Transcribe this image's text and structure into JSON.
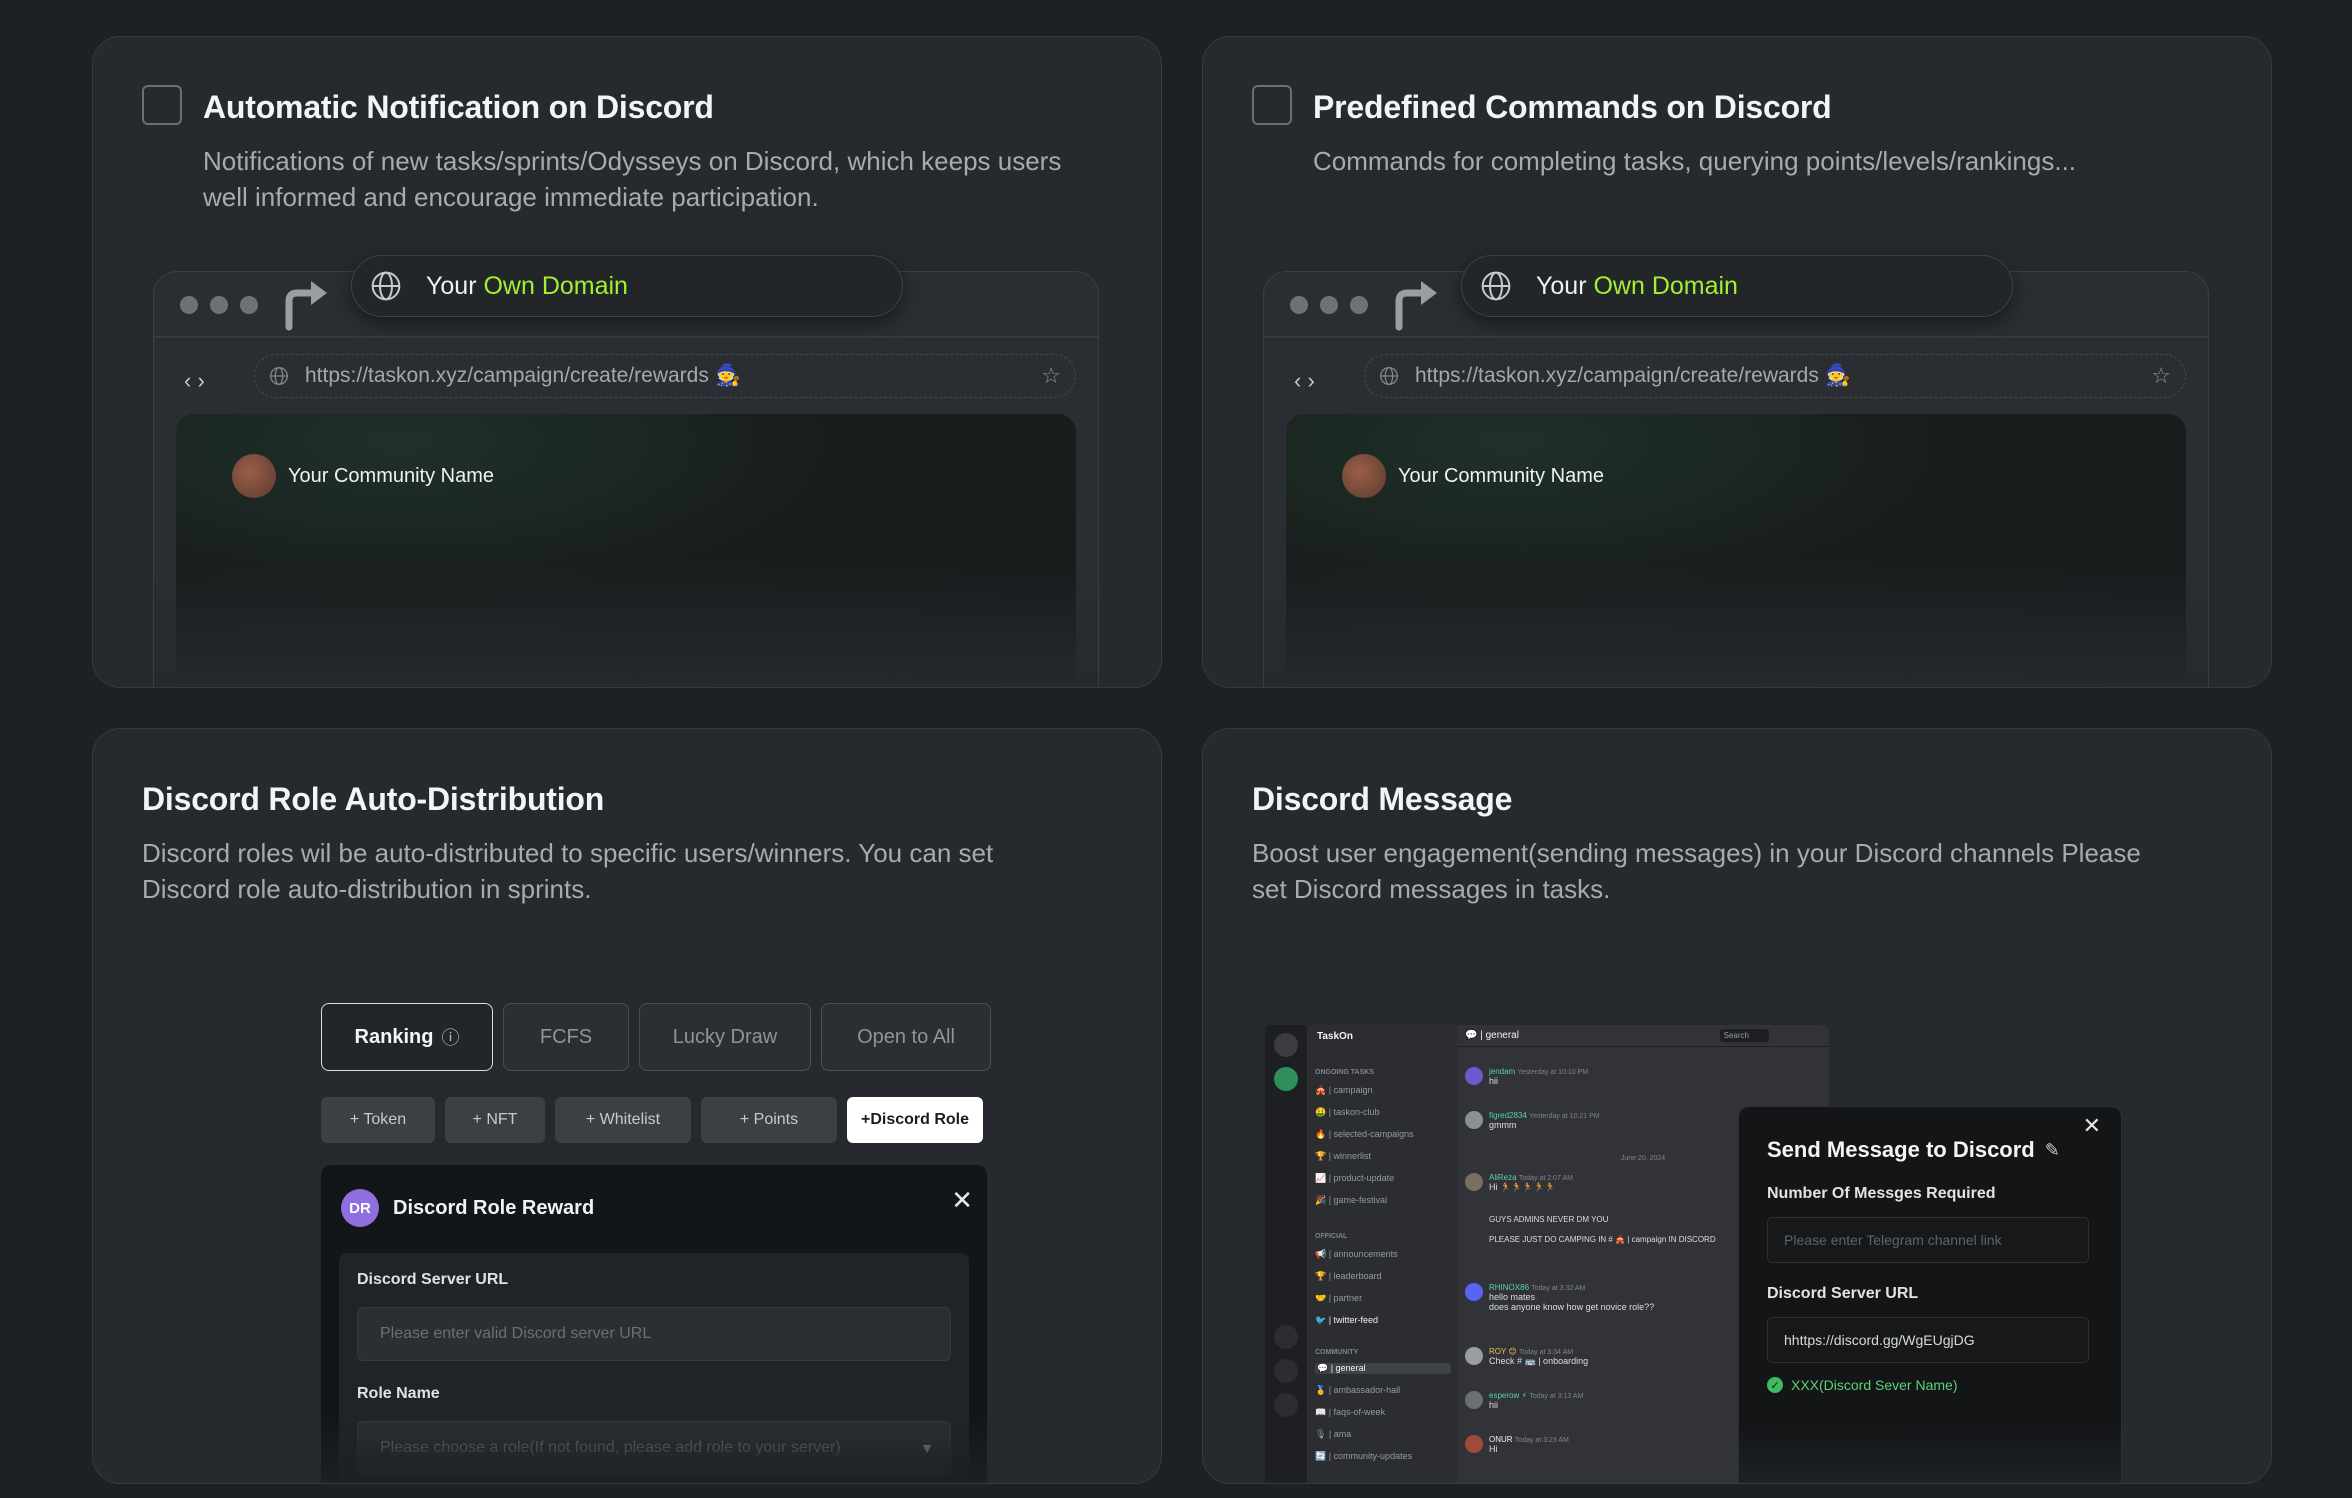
{
  "cards": [
    {
      "title": "Automatic Notification on Discord",
      "desc_line1": "Notifications of new tasks/sprints/Odysseys on Discord, which keeps users",
      "desc_line2": "well informed and encourage immediate participation."
    },
    {
      "title": "Predefined Commands on Discord",
      "desc_line1": "Commands for completing tasks, querying points/levels/rankings...",
      "desc_line2": ""
    },
    {
      "title": "Discord Role Auto-Distribution",
      "desc_line1": "Discord roles wil be auto-distributed to specific users/winners. You can set",
      "desc_line2": "Discord role auto-distribution in sprints."
    },
    {
      "title": "Discord Message",
      "desc_line1": "Boost user engagement(sending messages) in your Discord channels Please",
      "desc_line2": "set Discord messages in tasks."
    }
  ],
  "browser": {
    "domain_prefix": "Your ",
    "domain_highlight": "Own Domain",
    "url": "https://taskon.xyz/campaign/create/rewards 🧙",
    "community_name": "Your Community Name",
    "highlight_color": "#a3f033"
  },
  "role_reward": {
    "tabs": [
      "Ranking",
      "FCFS",
      "Lucky Draw",
      "Open to All"
    ],
    "tab_info_icon": "ⓘ",
    "chips": [
      "+ Token",
      "+ NFT",
      "+ Whitelist",
      "+ Points",
      "+Discord Role"
    ],
    "badge": "DR",
    "panel_title": "Discord Role Reward",
    "close": "✕",
    "server_url_label": "Discord Server URL",
    "server_url_placeholder": "Please enter valid Discord server URL",
    "role_name_label": "Role Name",
    "role_name_placeholder": "Please choose a role(If not found, please add role to your server)"
  },
  "discord": {
    "server": "TaskOn",
    "current_channel": "💬 | general",
    "search": "Search",
    "categories": [
      "ONGOING TASKS",
      "OFFICIAL",
      "COMMUNITY"
    ],
    "channels_ongoing": [
      "🎪 | campaign",
      "🤑 | taskon-club",
      "🔥 | selected-campaigns",
      "🏆 | winnerlist",
      "📈 | product-update",
      "🎉 | game-festival"
    ],
    "channels_official": [
      "📢 | announcements",
      "🏆 | leaderboard",
      "🤝 | partner",
      "🐦 | twitter-feed"
    ],
    "channels_community": [
      "💬 | general",
      "🏅 | ambassador-hall",
      "📖 | faqs-of-week",
      "🎙 | ama",
      "🔄 | community-updates"
    ],
    "date_divider": "June 20, 2024",
    "messages": [
      {
        "name": "jendam",
        "time": "Yesterday at 10:10 PM",
        "text": "hii"
      },
      {
        "name": "figred2834",
        "time": "Yesterday at 10:21 PM",
        "text": "gmmm"
      },
      {
        "name": "AliReza",
        "time": "Today at 2:07 AM",
        "text": "Hi 🏃🏃🏃🏃🏃"
      },
      {
        "name": "",
        "time": "",
        "text": "GUYS ADMINS NEVER DM YOU"
      },
      {
        "name": "",
        "time": "",
        "text": "PLEASE JUST DO CAMPING IN # 🎪 | campaign IN DISCORD"
      },
      {
        "name": "RHINOX86",
        "time": "Today at 3:32 AM",
        "text": "hello mates"
      },
      {
        "name": "",
        "time": "",
        "text": "does anyone know how get novice role??"
      },
      {
        "name": "ROY 😊",
        "time": "Today at 3:34 AM",
        "text": "Check # 🚌 | onboarding"
      },
      {
        "name": "esperow ⚡",
        "time": "Today at 3:13 AM",
        "text": "hii"
      },
      {
        "name": "ONUR",
        "time": "Today at 3:23 AM",
        "text": "Hi"
      }
    ]
  },
  "send_modal": {
    "title": "Send Message to Discord",
    "close": "✕",
    "count_label": "Number Of Messges Required",
    "count_placeholder": "Please enter Telegram channel link",
    "server_label": "Discord Server URL",
    "server_value": "hhttps://discord.gg/WgEUgjDG",
    "verified": "XXX(Discord Sever Name)",
    "verified_color": "#5ed17b"
  }
}
